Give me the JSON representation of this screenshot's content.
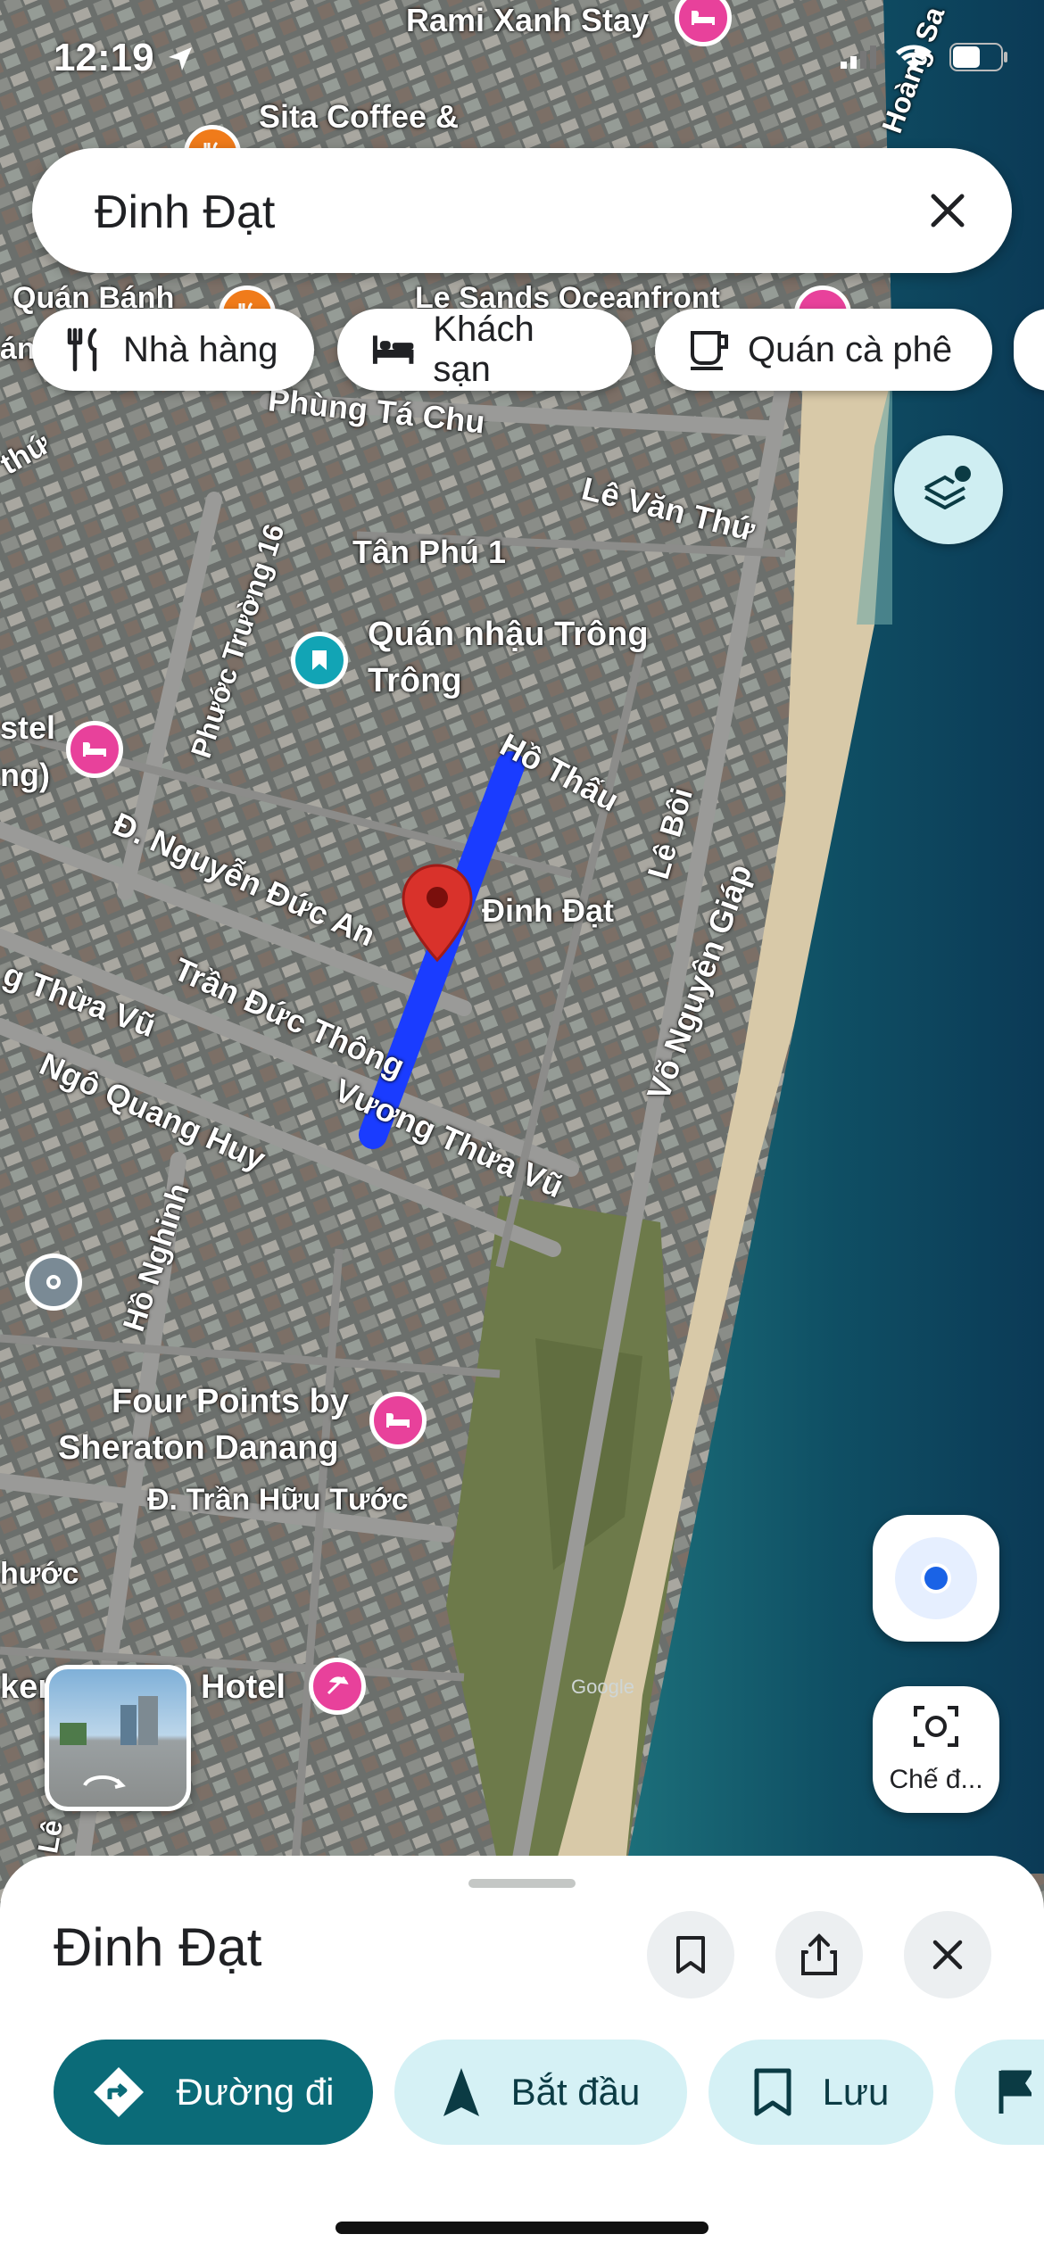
{
  "status_bar": {
    "time": "12:19"
  },
  "search": {
    "query": "Đinh Đạt"
  },
  "chips": [
    {
      "label": "Nhà hàng",
      "icon": "fork-knife-icon"
    },
    {
      "label": "Khách sạn",
      "icon": "bed-icon"
    },
    {
      "label": "Quán cà phê",
      "icon": "coffee-cup-icon"
    }
  ],
  "map": {
    "street_labels": {
      "phung_ta_chu": "Phùng Tá Chu",
      "le_van_thu": "Lê Văn Thứ",
      "tan_phu_1": "Tân Phú 1",
      "phuoc_truong_16": "Phước Trường 16",
      "ho_thau": "Hồ Thấu",
      "le_boi": "Lê Bôi",
      "nguyen_duc_an": "Đ. Nguyễn Đức An",
      "dinh_dat": "Đinh Đạt",
      "vo_nguyen_giap": "Võ Nguyên Giáp",
      "thua_vu_left": "g Thừa Vũ",
      "tran_duc_thong": "Trần Đức Thông",
      "ngo_quang_huy": "Ngô Quang Huy",
      "vuong_thua_vu": "Vương Thừa Vũ",
      "ho_nghinh": "Hồ Nghinh",
      "tran_huu_tuoc": "Đ. Trần Hữu Tước",
      "huoc": "hước",
      "hoang_sa": "Hoàng Sa",
      "le_partial": "Lê"
    },
    "place_labels": {
      "rami": "Rami Xanh Stay",
      "sita": "Sita Coffee &",
      "quan_banh": "Quán Bánh",
      "an": "án",
      "le_sands": "Le Sands Oceanfront",
      "thu": "thứ",
      "quan_nhau_1": "Quán nhậu Trông",
      "quan_nhau_2": "Trông",
      "stel": "stel",
      "ng": "ng)",
      "four_points_1": "Four Points by",
      "four_points_2": "Sheraton Danang",
      "hotel": "Hotel",
      "ken": "ken",
      "watermark": "Google"
    }
  },
  "buttons": {
    "camera_label": "Chế đ..."
  },
  "place_sheet": {
    "title": "Đinh Đạt",
    "actions": [
      {
        "label": "Đường đi",
        "icon": "directions-icon"
      },
      {
        "label": "Bắt đầu",
        "icon": "navigation-arrow-icon"
      },
      {
        "label": "Lưu",
        "icon": "bookmark-icon"
      }
    ]
  },
  "colors": {
    "accent_dark": "#0b6b78",
    "accent_light": "#d5f1f5",
    "route": "#1a3cff",
    "pin": "#d9322b"
  }
}
